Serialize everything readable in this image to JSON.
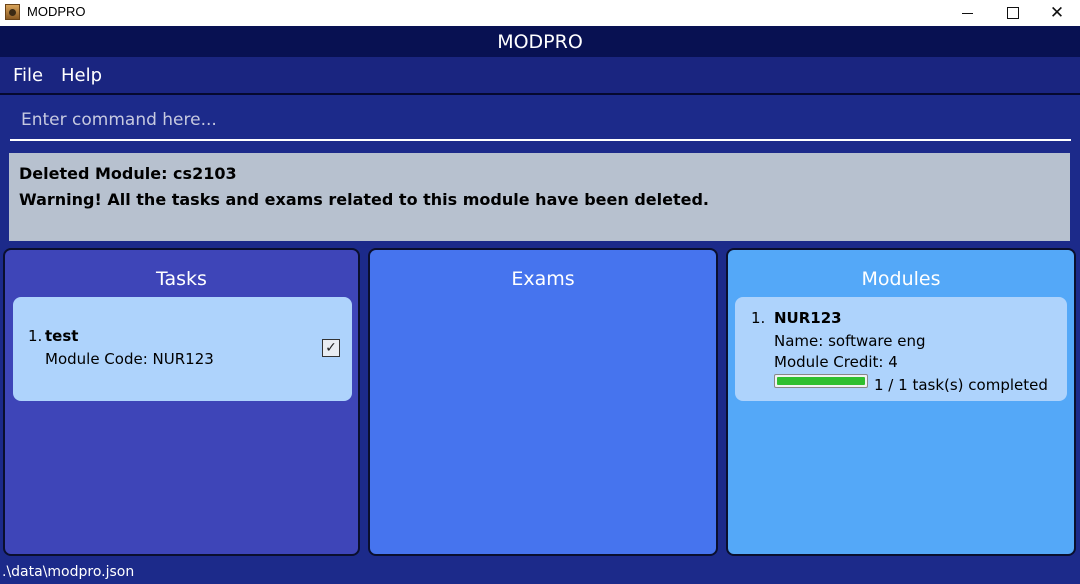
{
  "window": {
    "title": "MODPRO",
    "minimize": "—",
    "close": "✕"
  },
  "app": {
    "header_title": "MODPRO"
  },
  "menu": {
    "file": "File",
    "help": "Help"
  },
  "command": {
    "placeholder": "Enter command here...",
    "value": ""
  },
  "result": {
    "line1": "Deleted Module: cs2103",
    "line2": "Warning! All the tasks and exams related to this module have been deleted."
  },
  "tasks": {
    "title": "Tasks",
    "items": [
      {
        "index": "1.",
        "name": "test",
        "module_code": "Module Code: NUR123",
        "done": true,
        "check_glyph": "✓"
      }
    ]
  },
  "exams": {
    "title": "Exams",
    "items": []
  },
  "modules": {
    "title": "Modules",
    "items": [
      {
        "index": "1.",
        "code": "NUR123",
        "name": "Name: software eng",
        "credit": "Module Credit: 4",
        "progress_fraction": 1.0,
        "progress_text": "1 / 1 task(s) completed"
      }
    ]
  },
  "status": {
    "path": ".\\data\\modpro.json"
  },
  "colors": {
    "header_bg": "#081152",
    "menu_bg": "#1a2580",
    "main_bg": "#1c2a8a",
    "tasks_panel": "#3e45b8",
    "exams_panel": "#4674ee",
    "modules_panel": "#54a8f8",
    "card_bg": "#aed3fc",
    "result_bg": "#b7c1cf",
    "progress_fill": "#2fbf2f"
  }
}
